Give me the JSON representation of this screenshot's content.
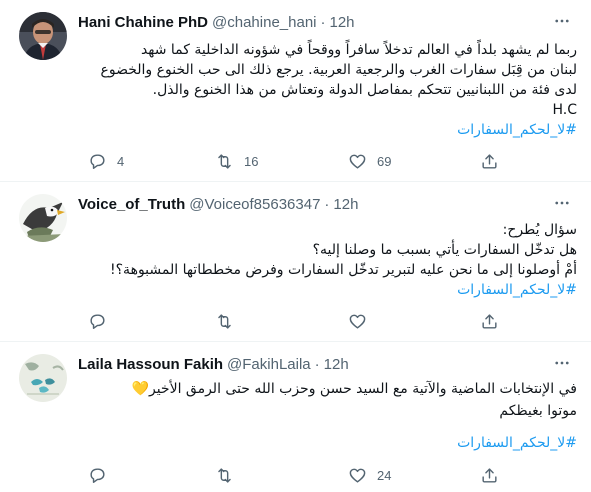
{
  "tweets": [
    {
      "display_name": "Hani Chahine PhD",
      "handle": "@chahine_hani",
      "separator": "·",
      "time": "12h",
      "lines": [
        "ربما لم يشهد بلداً في العالم تدخلاً سافراً ووقحاً في شؤونه الداخلية كما شهد",
        "لبنان من قِبَل سفارات الغرب والرجعية العربية. يرجع ذلك الى حب الخنوع والخضوع",
        "لدى فئة من اللبنانيين تتحكم بمفاصل الدولة وتعتاش من هذا الخنوع والذل.",
        "H.C"
      ],
      "hashtag": "#لا_لحكم_السفارات",
      "reply_count": "4",
      "retweet_count": "16",
      "like_count": "69"
    },
    {
      "display_name": "Voice_of_Truth",
      "handle": "@Voiceof85636347",
      "separator": "·",
      "time": "12h",
      "lines": [
        "سؤال يُطرح:",
        "هل تدخّل السفارات يأتي بسبب ما وصلنا إليه؟",
        "أمْ أوصلونا إلى ما نحن عليه لتبرير تدخّل السفارات وفرض مخططاتها المشبوهة؟!"
      ],
      "hashtag": "#لا_لحكم_السفارات",
      "reply_count": "",
      "retweet_count": "",
      "like_count": ""
    },
    {
      "display_name": "Laila Hassoun Fakih",
      "handle": "@FakihLaila",
      "separator": "·",
      "time": "12h",
      "lines": [
        "في الإنتخابات الماضية والآتية مع السيد حسن وحزب الله حتى الرمق الأخير💛",
        "موتوا بغيظكم"
      ],
      "hashtag": "#لا_لحكم_السفارات",
      "reply_count": "",
      "retweet_count": "",
      "like_count": "24"
    }
  ],
  "icons": {
    "more": "more-horizontal-icon",
    "reply": "reply-icon",
    "retweet": "retweet-icon",
    "like": "heart-icon",
    "share": "share-icon"
  },
  "colors": {
    "link": "#1d9bf0",
    "secondary_text": "#536471",
    "divider": "#eff3f4"
  }
}
